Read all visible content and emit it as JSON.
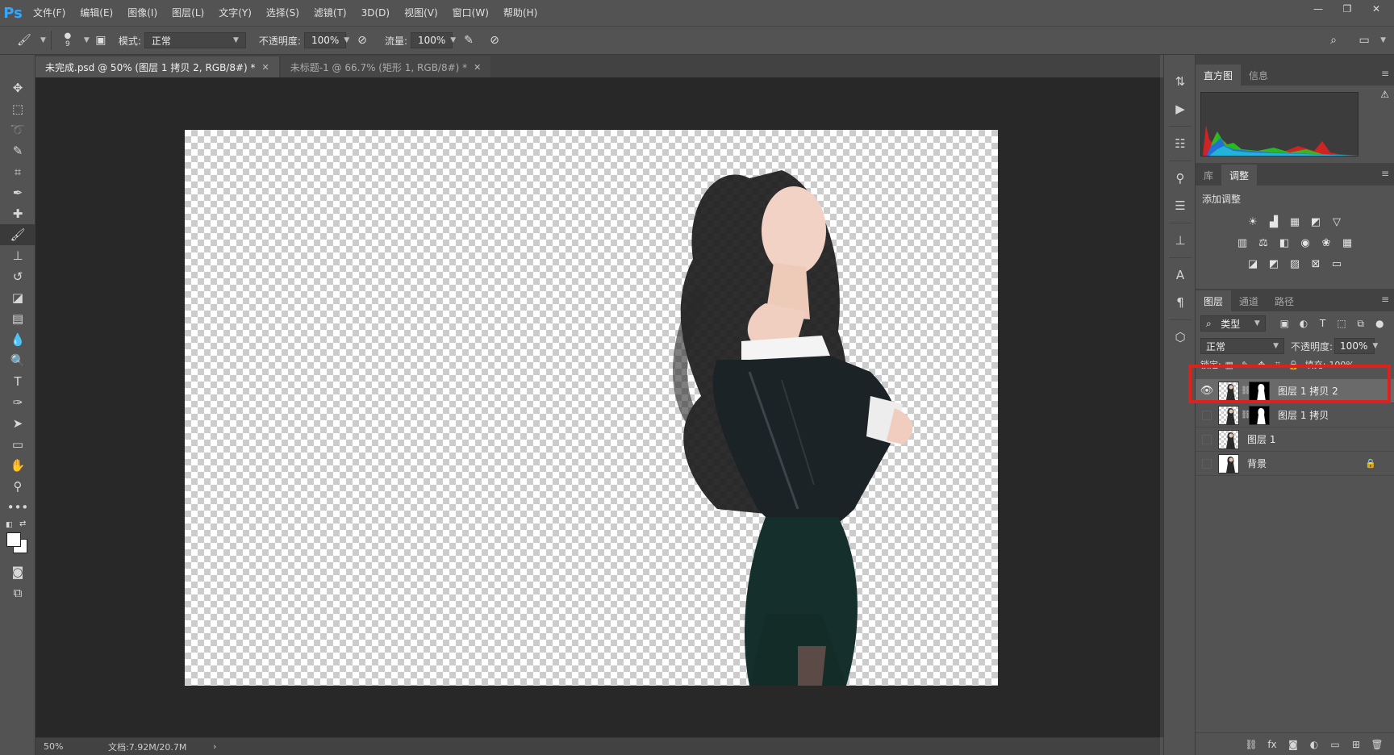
{
  "app": {
    "logo": "Ps"
  },
  "menu": [
    "文件(F)",
    "编辑(E)",
    "图像(I)",
    "图层(L)",
    "文字(Y)",
    "选择(S)",
    "滤镜(T)",
    "3D(D)",
    "视图(V)",
    "窗口(W)",
    "帮助(H)"
  ],
  "window_controls": {
    "minimize": "—",
    "restore": "❐",
    "close": "✕"
  },
  "options": {
    "brush_size": "9",
    "mode_label": "模式:",
    "mode_value": "正常",
    "opacity_label": "不透明度:",
    "opacity_value": "100%",
    "flow_label": "流量:",
    "flow_value": "100%"
  },
  "tabs": [
    {
      "label": "未完成.psd @ 50% (图层 1 拷贝 2, RGB/8#) *",
      "close": "✕"
    },
    {
      "label": "未标题-1 @ 66.7% (矩形 1, RGB/8#) *",
      "close": "✕"
    }
  ],
  "status": {
    "zoom": "50%",
    "doc": "文档:7.92M/20.7M",
    "arrow": "›"
  },
  "histogram": {
    "tabs": [
      "直方图",
      "信息"
    ],
    "warning": "⚠"
  },
  "adjustments": {
    "tabs": [
      "库",
      "调整"
    ],
    "title": "添加调整"
  },
  "layers": {
    "tabs": [
      "图层",
      "通道",
      "路径"
    ],
    "filter_value": "类型",
    "blend_value": "正常",
    "opacity_label": "不透明度:",
    "opacity_value": "100%",
    "lock_label": "锁定:",
    "fill_label": "填充:",
    "fill_value": "100%",
    "items": [
      {
        "name": "图层 1 拷贝 2",
        "visible": true,
        "selected": true
      },
      {
        "name": "图层 1 拷贝",
        "visible": false,
        "selected": false
      },
      {
        "name": "图层 1",
        "visible": false,
        "selected": false
      },
      {
        "name": "背景",
        "visible": false,
        "selected": false,
        "locked": true
      }
    ]
  },
  "colors": {
    "accent": "#31a8ff",
    "highlight": "#e0201c",
    "selected_layer": "#6a6a6a"
  }
}
